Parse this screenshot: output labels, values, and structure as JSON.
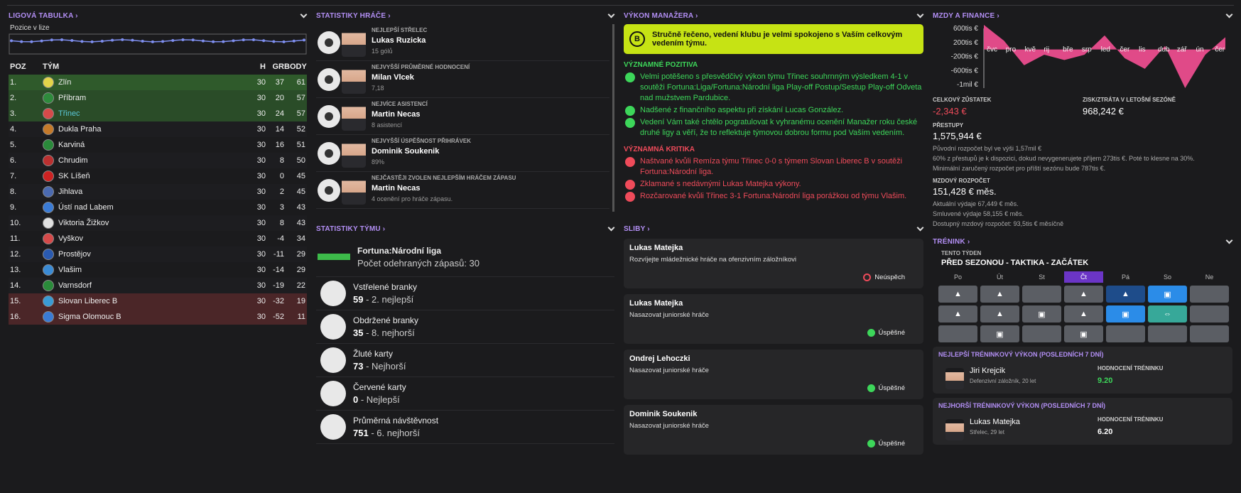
{
  "league": {
    "title": "LIGOVÁ TABULKA",
    "subtitle": "Pozice v lize",
    "headers": {
      "pos": "POZ",
      "team": "TÝM",
      "h": "H",
      "gr": "GR",
      "pts": "BODY"
    },
    "rows": [
      {
        "pos": "1.",
        "team": "Zlín",
        "h": "30",
        "gr": "37",
        "pts": "61",
        "bg": "#2f5a2b",
        "crest": "#e3d44a"
      },
      {
        "pos": "2.",
        "team": "Příbram",
        "h": "30",
        "gr": "20",
        "pts": "57",
        "bg": "#2a4c28",
        "crest": "#2e8b3c"
      },
      {
        "pos": "3.",
        "team": "Třinec",
        "h": "30",
        "gr": "24",
        "pts": "57",
        "bg": "#2a4c28",
        "crest": "#d54a4a",
        "hl": true
      },
      {
        "pos": "4.",
        "team": "Dukla Praha",
        "h": "30",
        "gr": "14",
        "pts": "52",
        "bg": "#1d1d20",
        "crest": "#c57a2a"
      },
      {
        "pos": "5.",
        "team": "Karviná",
        "h": "30",
        "gr": "16",
        "pts": "51",
        "bg": "#1b1b1d",
        "crest": "#2a8a3a"
      },
      {
        "pos": "6.",
        "team": "Chrudim",
        "h": "30",
        "gr": "8",
        "pts": "50",
        "bg": "#1d1d20",
        "crest": "#bb3030"
      },
      {
        "pos": "7.",
        "team": "SK Líšeň",
        "h": "30",
        "gr": "0",
        "pts": "45",
        "bg": "#1b1b1d",
        "crest": "#cc2222"
      },
      {
        "pos": "8.",
        "team": "Jihlava",
        "h": "30",
        "gr": "2",
        "pts": "45",
        "bg": "#1d1d20",
        "crest": "#4b6ab0"
      },
      {
        "pos": "9.",
        "team": "Ústí nad Labem",
        "h": "30",
        "gr": "3",
        "pts": "43",
        "bg": "#1b1b1d",
        "crest": "#3a7bd5"
      },
      {
        "pos": "10.",
        "team": "Viktoria Žižkov",
        "h": "30",
        "gr": "8",
        "pts": "43",
        "bg": "#1d1d20",
        "crest": "#e0e0e0"
      },
      {
        "pos": "11.",
        "team": "Vyškov",
        "h": "30",
        "gr": "-4",
        "pts": "34",
        "bg": "#1b1b1d",
        "crest": "#d54a4a"
      },
      {
        "pos": "12.",
        "team": "Prostějov",
        "h": "30",
        "gr": "-11",
        "pts": "29",
        "bg": "#1d1d20",
        "crest": "#2a5ab0"
      },
      {
        "pos": "13.",
        "team": "Vlašim",
        "h": "30",
        "gr": "-14",
        "pts": "29",
        "bg": "#1b1b1d",
        "crest": "#3a8bd5"
      },
      {
        "pos": "14.",
        "team": "Varnsdorf",
        "h": "30",
        "gr": "-19",
        "pts": "22",
        "bg": "#1d1d20",
        "crest": "#2a8a3a"
      },
      {
        "pos": "15.",
        "team": "Slovan Liberec B",
        "h": "30",
        "gr": "-32",
        "pts": "19",
        "bg": "#4b2628",
        "crest": "#3a9bd5"
      },
      {
        "pos": "16.",
        "team": "Sigma Olomouc B",
        "h": "30",
        "gr": "-52",
        "pts": "11",
        "bg": "#4b2628",
        "crest": "#3a7bd5"
      }
    ],
    "chart_data": {
      "type": "line",
      "values": [
        3,
        3,
        3,
        3,
        3,
        3,
        3,
        3,
        3,
        3,
        3,
        3,
        3,
        3,
        3,
        3,
        3,
        3,
        3,
        3,
        3,
        3,
        3,
        3,
        3,
        3,
        3,
        3,
        3,
        3
      ]
    }
  },
  "players": {
    "title": "STATISTIKY HRÁČE",
    "rows": [
      {
        "tag": "NEJLEPŠÍ STŘELEC",
        "name": "Lukas Ruzicka",
        "val": "15 gólů",
        "icon": "football-icon"
      },
      {
        "tag": "NEJVYŠŠÍ PRŮMĚRNÉ HODNOCENÍ",
        "name": "Milan Vlcek",
        "val": "7,18",
        "icon": "gear-icon"
      },
      {
        "tag": "NEJVÍCE ASISTENCÍ",
        "name": "Martin Necas",
        "val": "8 asistencí",
        "icon": "assist-icon"
      },
      {
        "tag": "NEJVYŠŠÍ ÚSPĚŠNOST PŘIHRÁVEK",
        "name": "Dominik Soukenik",
        "val": "89%",
        "icon": "percent-icon"
      },
      {
        "tag": "NEJČASTĚJI ZVOLEN NEJLEPŠÍM HRÁČEM ZÁPASU",
        "name": "Martin Necas",
        "val": "4 ocenění pro hráče zápasu.",
        "icon": "star-icon"
      }
    ]
  },
  "team": {
    "title": "STATISTIKY TÝMU",
    "league": "Fortuna:Národní liga",
    "matches": "Počet odehraných zápasů: 30",
    "rows": [
      {
        "label": "Vstřelené branky",
        "num": "59",
        "rest": " - 2. nejlepší",
        "icon": "goal-scored-icon"
      },
      {
        "label": "Obdržené branky",
        "num": "35",
        "rest": " - 8. nejhorší",
        "icon": "goal-conceded-icon"
      },
      {
        "label": "Žluté karty",
        "num": "73",
        "rest": " - Nejhorší",
        "icon": "yellow-card-icon"
      },
      {
        "label": "Červené karty",
        "num": "0",
        "rest": " - Nejlepší",
        "icon": "red-card-icon"
      },
      {
        "label": "Průměrná návštěvnost",
        "num": "751",
        "rest": " - 6. nejhorší",
        "icon": "stadium-icon"
      }
    ]
  },
  "manager": {
    "title": "VÝKON MANAŽERA",
    "grade": "B",
    "summary": "Stručně řečeno, vedení klubu je velmi spokojeno s Vaším celkovým vedením týmu.",
    "pos_title": "VÝZNAMNÉ POZITIVA",
    "positives": [
      "Velmi potěšeno s přesvědčivý výkon týmu Třinec souhrnným výsledkem 4-1 v soutěži Fortuna:Liga/Fortuna:Národní liga Play-off Postup/Sestup Play-off Odveta nad mužstvem Pardubice.",
      "Nadšené z finančního aspektu při získání Lucas González.",
      "Vedení Vám také chtělo pogratulovat k vyhranému ocenění Manažer roku české druhé ligy a věří, že to reflektuje týmovou dobrou formu pod Vaším vedením."
    ],
    "neg_title": "VÝZNAMNÁ KRITIKA",
    "negatives": [
      "Naštvané kvůli Remíza týmu Třinec 0-0 s týmem Slovan Liberec B v soutěži Fortuna:Národní liga.",
      "Zklamané s nedávnými Lukas Matejka výkony.",
      "Rozčarované kvůli Třinec 3-1 Fortuna:Národní liga porážkou od týmu Vlašim."
    ]
  },
  "promises": {
    "title": "SLIBY",
    "items": [
      {
        "name": "Lukas Matejka",
        "desc": "Rozvíjejte mládežnické hráče na ofenzivním záložníkovi",
        "status": "Neúspěch",
        "ok": false
      },
      {
        "name": "Lukas Matejka",
        "desc": "Nasazovat juniorské hráče",
        "status": "Úspěšné",
        "ok": true
      },
      {
        "name": "Ondrej Lehoczki",
        "desc": "Nasazovat juniorské hráče",
        "status": "Úspěšné",
        "ok": true
      },
      {
        "name": "Dominik Soukenik",
        "desc": "Nasazovat juniorské hráče",
        "status": "Úspěšné",
        "ok": true
      }
    ]
  },
  "finance": {
    "title": "MZDY A FINANCE",
    "yticks": [
      "600tis €",
      "200tis €",
      "-200tis €",
      "-600tis €",
      "-1mil €"
    ],
    "months": [
      "čvc",
      "pro",
      "kvě",
      "rij",
      "bře",
      "srp",
      "led",
      "čer",
      "lis",
      "dub",
      "zář",
      "ún",
      "čer"
    ],
    "chart_data": {
      "type": "area",
      "values": [
        700,
        250,
        -450,
        -150,
        -300,
        -150,
        400,
        -250,
        -550,
        100,
        -1100,
        -150,
        350
      ]
    },
    "balance_label": "CELKOVÝ ZŮSTATEK",
    "balance": "-2,343 €",
    "profit_label": "ZISK/ZTRÁTA V LETOŠNÍ SEZÓNĚ",
    "profit": "968,242 €",
    "transfers_label": "PŘESTUPY",
    "transfers": "1,575,944 €",
    "transfers_notes": [
      "Původní rozpočet byl ve výši 1,57mil €",
      "60% z přestupů je k dispozici, dokud nevygenerujete příjem 273tis €. Poté to klesne na 30%.",
      "Minimální zaručený rozpočet pro příští sezónu bude 787tis €."
    ],
    "wage_label": "MZDOVÝ ROZPOČET",
    "wage": "151,428 € měs.",
    "wage_notes": [
      "Aktuální výdaje 67,449 € měs.",
      "Smluvené výdaje 58,155 € měs.",
      "Dostupný mzdový rozpočet: 93,5tis € měsíčně"
    ]
  },
  "training": {
    "title": "TRÉNINK",
    "week_label": "TENTO TÝDEN",
    "schedule": "PŘED SEZONOU - TAKTIKA - ZAČÁTEK",
    "days": [
      "Po",
      "Út",
      "St",
      "Čt",
      "Pá",
      "So",
      "Ne"
    ],
    "best_title": "NEJLEPŠÍ TRÉNINKOVÝ VÝKON (POSLEDNÍCH 7 DNÍ)",
    "best_name": "Jiri Krejcik",
    "best_pos": "Defenzivní záložník, 20 let",
    "best_rating": "9.20",
    "worst_title": "NEJHORŠÍ TRÉNINKOVÝ VÝKON (POSLEDNÍCH 7 DNÍ)",
    "worst_name": "Lukas Matejka",
    "worst_pos": "Střelec, 29 let",
    "worst_rating": "6.20",
    "rating_label": "HODNOCENÍ TRÉNINKU"
  }
}
